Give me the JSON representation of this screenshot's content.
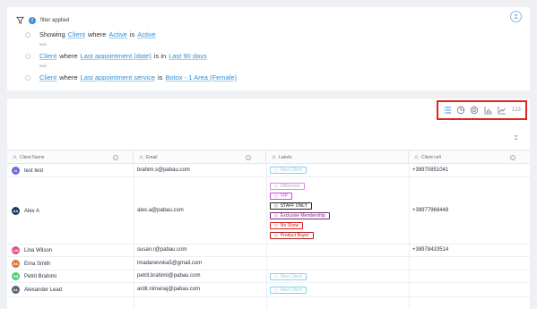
{
  "filter": {
    "count": "2",
    "label": "filter applied",
    "conditions": [
      {
        "prefix": "Showing",
        "field": "Client",
        "w1": "where",
        "attr": "Active",
        "op": "is",
        "val": "Active"
      },
      {
        "field": "Client",
        "w1": "where",
        "attr": "Last appointment (date)",
        "op": "is in",
        "val": "Last 90 days"
      },
      {
        "field": "Client",
        "w1": "where",
        "attr": "Last appointment service",
        "op": "is",
        "val": "Botox - 1 Area (Female)"
      }
    ],
    "and_label": "and"
  },
  "toolbar": {
    "number_label": "123"
  },
  "table": {
    "columns": [
      "Client Name",
      "Email",
      "Labels",
      "Client cell"
    ],
    "rows": [
      {
        "initials": "tt",
        "avatar_color": "#6f6fd6",
        "name": "test test",
        "email": "brahim.s@pabau.com",
        "cell": "+38970851041",
        "labels": [
          {
            "text": "New Client",
            "color": "#8ed2ea",
            "icon": "◇"
          }
        ]
      },
      {
        "initials": "AA",
        "avatar_color": "#1d3a55",
        "name": "Alex A",
        "email": "alex.a@pabau.com",
        "cell": "+38977968448",
        "labels": [
          {
            "text": "Influencer",
            "color": "#d58ae0",
            "icon": "◇"
          },
          {
            "text": "VIP",
            "color": "#c24fd6",
            "icon": "◇"
          },
          {
            "text": "STAFF ONLY",
            "color": "#222222",
            "icon": "◇"
          },
          {
            "text": "Exclusive Membership",
            "color": "#7a2a78",
            "icon": "◇"
          },
          {
            "text": "No Show",
            "color": "#d8201d",
            "icon": "◇"
          },
          {
            "text": "Product Buyer",
            "color": "#b31d1d",
            "icon": "◇"
          }
        ]
      },
      {
        "initials": "LW",
        "avatar_color": "#e2517f",
        "name": "Lina Wilson",
        "email": "susan.r@pabau.com",
        "cell": "+38978433514",
        "labels": []
      },
      {
        "initials": "ES",
        "avatar_color": "#d9773a",
        "name": "Ema Smith",
        "email": "lmadanevska5@gmail.com",
        "cell": "",
        "labels": []
      },
      {
        "initials": "PB",
        "avatar_color": "#4ecf7b",
        "name": "Petrit Brahimi",
        "email": "petrit.brahimi@pabau.com",
        "cell": "",
        "labels": [
          {
            "text": "New Client",
            "color": "#8ed2ea",
            "icon": "◇"
          }
        ]
      },
      {
        "initials": "AL",
        "avatar_color": "#596479",
        "name": "Alexander Lead",
        "email": "ardit.nimanaj@pabau.com",
        "cell": "",
        "labels": [
          {
            "text": "New Client",
            "color": "#8ed2ea",
            "icon": "◇"
          }
        ]
      }
    ]
  }
}
